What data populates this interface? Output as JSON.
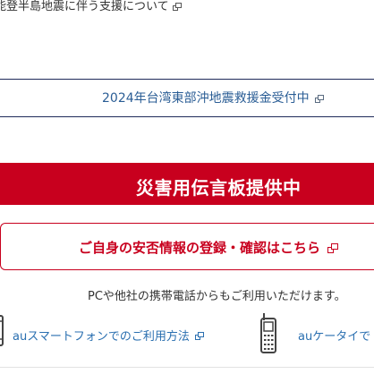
{
  "top_notice": {
    "label": "能登半島地震に伴う支援について",
    "icon": "external-link-icon"
  },
  "taiwan_donation": {
    "label": "2024年台湾東部沖地震救援金受付中",
    "icon": "external-link-icon",
    "border_color": "#1f2a5a",
    "text_color": "#2a5d95"
  },
  "disaster_board": {
    "title": "災害用伝言板提供中",
    "background": "#c8001e"
  },
  "safety_check": {
    "label": "ご自身の安否情報の登録・確認はこちら",
    "icon": "external-link-icon",
    "color": "#c8001e"
  },
  "pc_note": "PCや他社の携帯電話からもご利用いただけます。",
  "device_links": {
    "smartphone": {
      "label": "auスマートフォンでのご利用方法",
      "icon": "smartphone-icon",
      "link_icon": "external-link-icon"
    },
    "keitai": {
      "label": "auケータイで",
      "icon": "feature-phone-icon"
    },
    "link_color": "#2a6fb0"
  }
}
